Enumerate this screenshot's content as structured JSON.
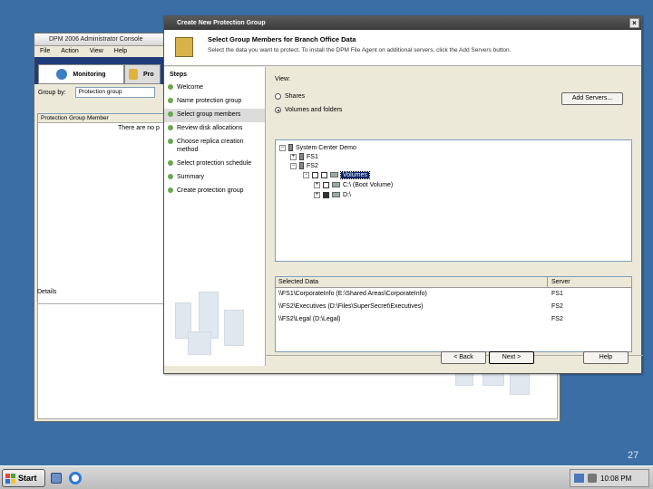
{
  "console": {
    "title": "DPM 2006 Administrator Console",
    "menu": [
      "File",
      "Action",
      "View",
      "Help"
    ],
    "tabs": [
      "Monitoring",
      "Pro"
    ],
    "group_by_label": "Group by:",
    "group_by_value": "Protection group",
    "list_header": "Protection Group Member",
    "empty_text": "There are no p",
    "details_label": "Details"
  },
  "wizard": {
    "title": "Create New Protection Group",
    "heading": "Select Group Members for Branch Office Data",
    "subheading": "Select the data you want to protect. To install the DPM File Agent on additional servers, click the Add Servers button.",
    "steps_header": "Steps",
    "steps": [
      "Welcome",
      "Name protection group",
      "Select group members",
      "Review disk allocations",
      "Choose replica creation method",
      "Select protection schedule",
      "Summary",
      "Create protection group"
    ],
    "active_step": 2,
    "view_label": "View:",
    "view_options": [
      "Shares",
      "Volumes and folders"
    ],
    "view_selected": 1,
    "add_servers_label": "Add Servers...",
    "tree": {
      "root": "System Center Demo",
      "server1": "FS1",
      "server2": "FS2",
      "items": [
        "Volumes",
        "C:\\ (Boot Volume)",
        "D:\\"
      ]
    },
    "selected_grid": {
      "headers": [
        "Selected Data",
        "Server"
      ],
      "rows": [
        [
          "\\\\FS1\\CorporateInfo (E:\\Shared Areas\\CorporateInfo)",
          "FS1"
        ],
        [
          "\\\\FS2\\Executives (D:\\Files\\SuperSecret\\Executives)",
          "FS2"
        ],
        [
          "\\\\FS2\\Legal (D:\\Legal)",
          "FS2"
        ]
      ]
    },
    "buttons": {
      "back": "< Back",
      "next": "Next >",
      "help": "Help"
    }
  },
  "taskbar": {
    "start_label": "Start",
    "clock": "10:08 PM"
  },
  "slide_number": "27"
}
